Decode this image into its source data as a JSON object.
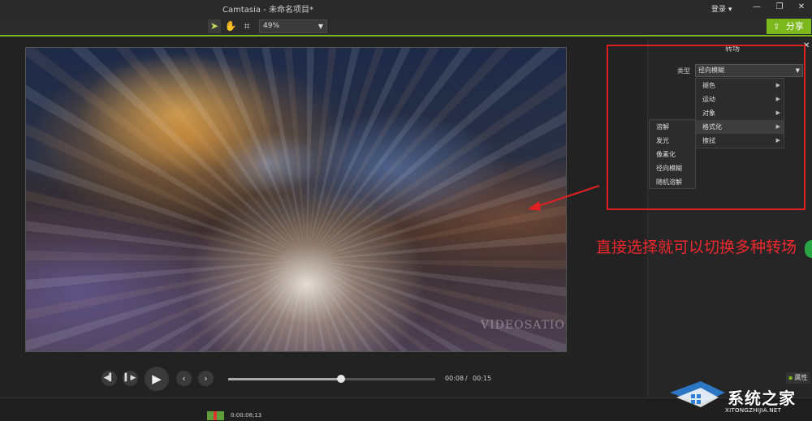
{
  "window": {
    "title": "Camtasia - 未命名项目*",
    "login_label": "登录 ▾",
    "minimize": "—",
    "restore": "❐",
    "close": "✕"
  },
  "toolbar": {
    "zoom_value": "49%",
    "share_label": "分享",
    "accent_color": "#7cb71d"
  },
  "canvas": {
    "watermark": "VIDEOSATION"
  },
  "playback": {
    "current_time": "00:08",
    "separator": "/",
    "total_time": "00:15",
    "progress_fraction": 0.544
  },
  "panel": {
    "title": "转场",
    "close": "✕",
    "type_label": "类型",
    "type_value": "径向模糊",
    "categories": [
      {
        "label": "褪色"
      },
      {
        "label": "运动"
      },
      {
        "label": "对象"
      },
      {
        "label": "格式化"
      },
      {
        "label": "擦拭"
      }
    ],
    "submenu": [
      {
        "label": "溶解"
      },
      {
        "label": "发光"
      },
      {
        "label": "像素化"
      },
      {
        "label": "径向模糊"
      },
      {
        "label": "随机溶解"
      }
    ],
    "properties_label": "属性"
  },
  "annotation": {
    "text": "直接选择就可以切换多种转场",
    "color": "#f0282d"
  },
  "timeline": {
    "playhead_time": "0:00:08;13"
  },
  "watermark_logo": {
    "name": "系统之家",
    "url": "XITONGZHIJIA.NET"
  }
}
